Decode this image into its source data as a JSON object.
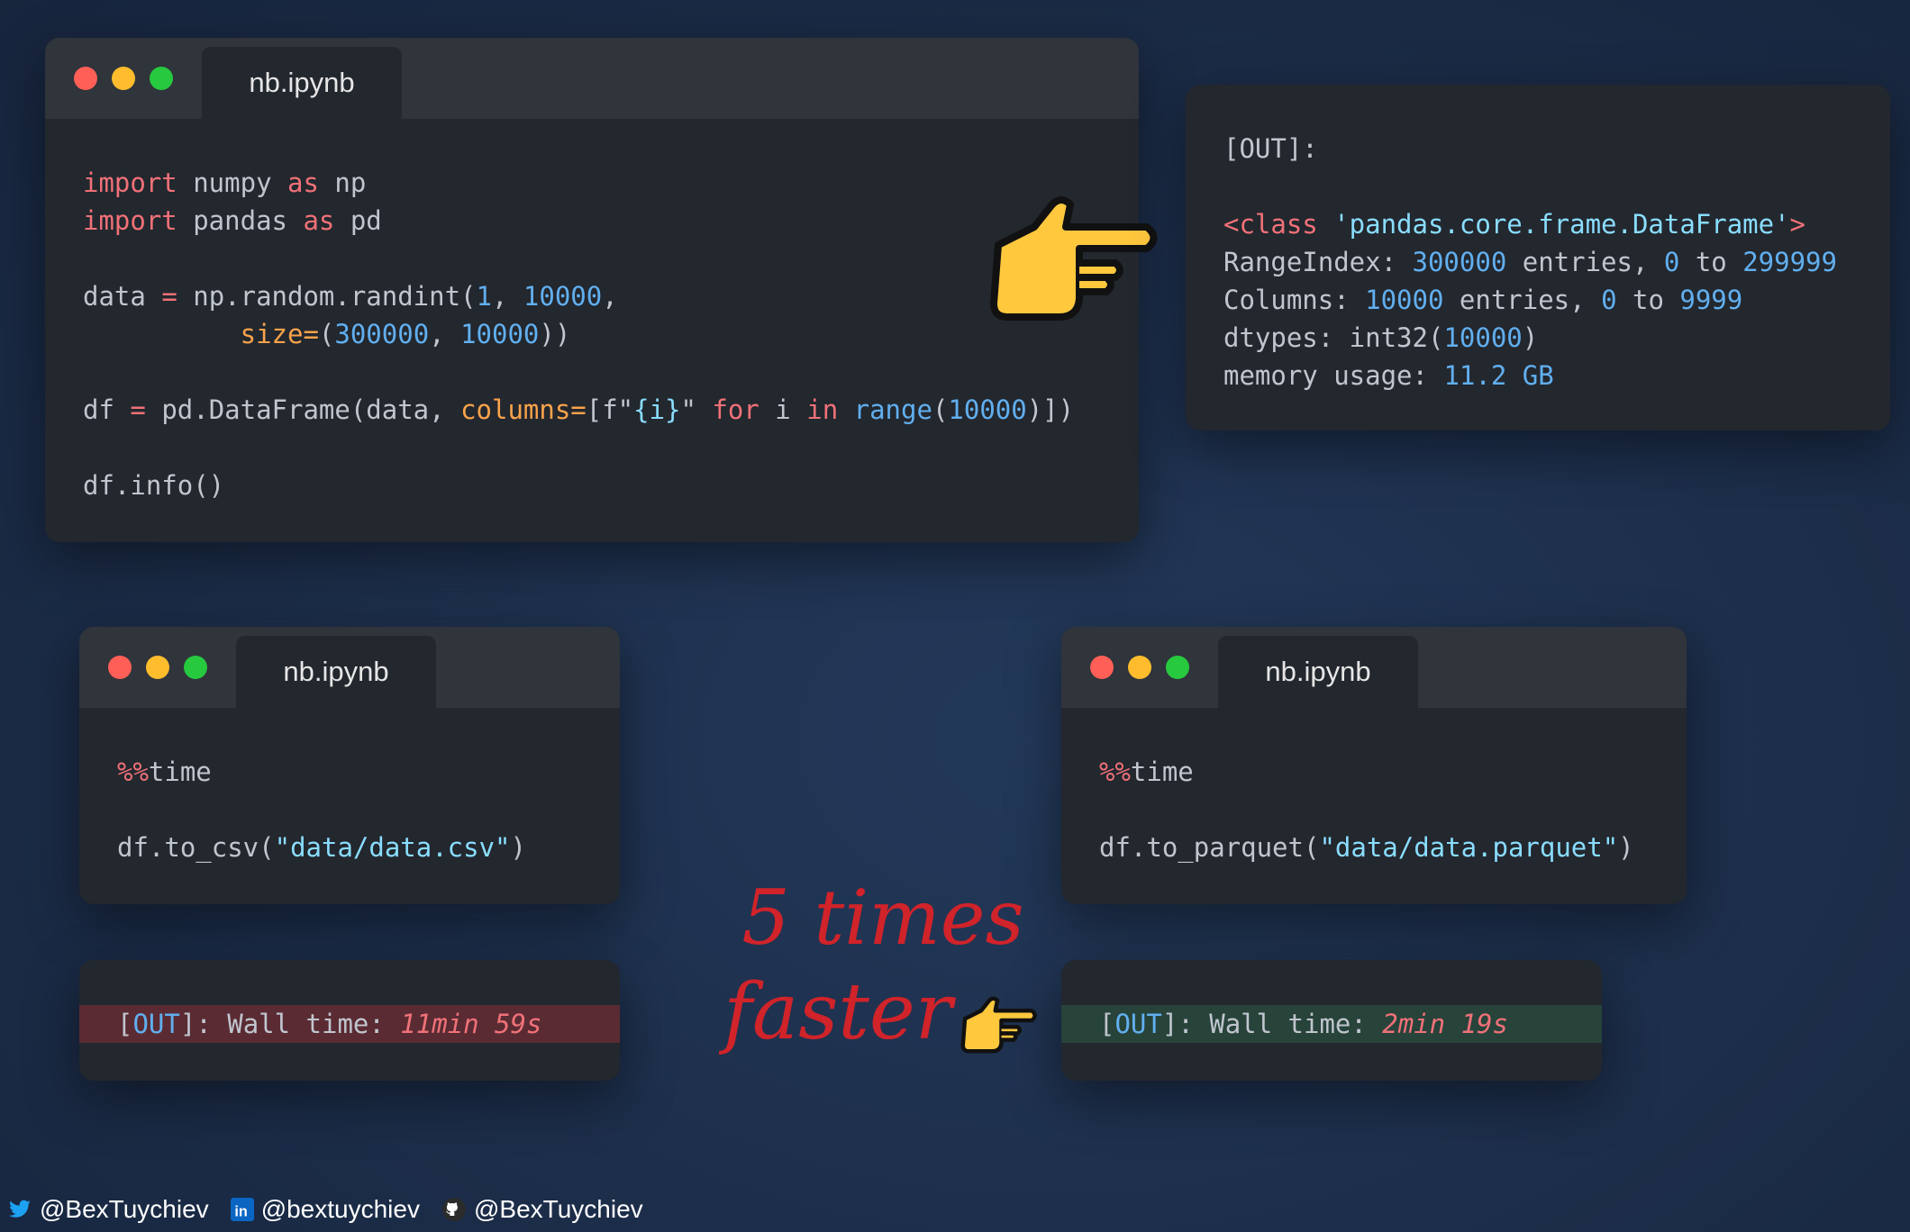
{
  "colors": {
    "keyword": "#f07178",
    "number": "#61afef",
    "string": "#89ddff",
    "argument": "#f8a34b",
    "text": "#c0c5ce",
    "window_bg": "#23272e",
    "titlebar_bg": "#30343b",
    "slow_strip": "#5a2b33",
    "fast_strip": "#27433a",
    "annotation": "#d0232a"
  },
  "main_window": {
    "tab_label": "nb.ipynb",
    "lines": {
      "l1_kw": "import",
      "l1_mod": " numpy ",
      "l1_as": "as",
      "l1_alias": " np",
      "l2_kw": "import",
      "l2_mod": " pandas ",
      "l2_as": "as",
      "l2_alias": " pd",
      "l3_a": "data ",
      "l3_eq": "=",
      "l3_b": " np.random.randint(",
      "l3_n1": "1",
      "l3_c": ", ",
      "l3_n2": "10000",
      "l3_d": ",",
      "l4_indent": "          ",
      "l4_arg": "size=",
      "l4_a": "(",
      "l4_n1": "300000",
      "l4_b": ", ",
      "l4_n2": "10000",
      "l4_c": "))",
      "l5_a": "df ",
      "l5_eq": "=",
      "l5_b": " pd.DataFrame(data, ",
      "l5_arg": "columns=",
      "l5_c": "[f\"",
      "l5_str": "{i}",
      "l5_d": "\" ",
      "l5_for": "for",
      "l5_e": " i ",
      "l5_in": "in",
      "l5_f": " ",
      "l5_range": "range",
      "l5_g": "(",
      "l5_n": "10000",
      "l5_h": ")])",
      "l6": "df.info()"
    }
  },
  "output_panel": {
    "header": "[OUT]:",
    "class_open": "<class ",
    "class_name": "'pandas.core.frame.DataFrame'",
    "class_close": ">",
    "range_label": "RangeIndex: ",
    "range_entries": "300000",
    "range_mid": " entries, ",
    "range_start": "0",
    "range_to": " to ",
    "range_end": "299999",
    "cols_label": "Columns: ",
    "cols_entries": "10000",
    "cols_mid": " entries, ",
    "cols_start": "0",
    "cols_to": " to ",
    "cols_end": "9999",
    "dtypes_label": "dtypes: int32(",
    "dtypes_n": "10000",
    "dtypes_close": ")",
    "mem_label": "memory usage: ",
    "mem_value": "11.2 GB"
  },
  "csv_window": {
    "tab_label": "nb.ipynb",
    "magic_pct": "%%",
    "magic_cmd": "time",
    "call_a": "df.to_csv(",
    "call_str": "\"data/data.csv\"",
    "call_b": ")"
  },
  "parquet_window": {
    "tab_label": "nb.ipynb",
    "magic_pct": "%%",
    "magic_cmd": "time",
    "call_a": "df.to_parquet(",
    "call_str": "\"data/data.parquet\"",
    "call_b": ")"
  },
  "csv_result": {
    "out_a": "[",
    "out_b": "OUT",
    "out_c": "]: Wall time: ",
    "time": "11min 59s"
  },
  "parquet_result": {
    "out_a": "[",
    "out_b": "OUT",
    "out_c": "]: Wall time: ",
    "time": "2min 19s"
  },
  "annotation": {
    "line1": "5 times",
    "line2": "faster"
  },
  "footer": {
    "twitter": "@BexTuychiev",
    "linkedin": "@bextuychiev",
    "github": "@BexTuychiev"
  }
}
